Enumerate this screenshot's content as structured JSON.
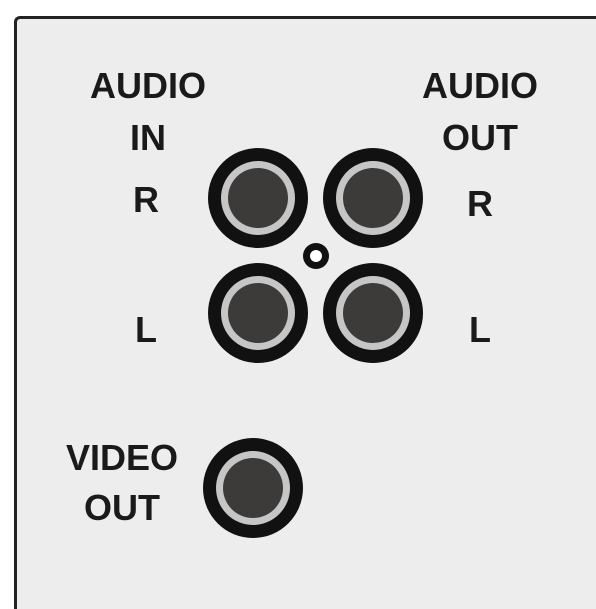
{
  "panel": {
    "audio_in": {
      "line1": "AUDIO",
      "line2": "IN",
      "right": "R",
      "left": "L"
    },
    "audio_out": {
      "line1": "AUDIO",
      "line2": "OUT",
      "right": "R",
      "left": "L"
    },
    "video_out": {
      "line1": "VIDEO",
      "line2": "OUT"
    }
  },
  "colors": {
    "background": "#ededed",
    "jack_outer": "#111111",
    "jack_ring": "#c6c6c6",
    "jack_inner": "#3d3a3a",
    "text": "#1a1a1a"
  },
  "icons": {
    "jack": "rca-jack-icon",
    "indicator": "center-indicator-icon"
  }
}
